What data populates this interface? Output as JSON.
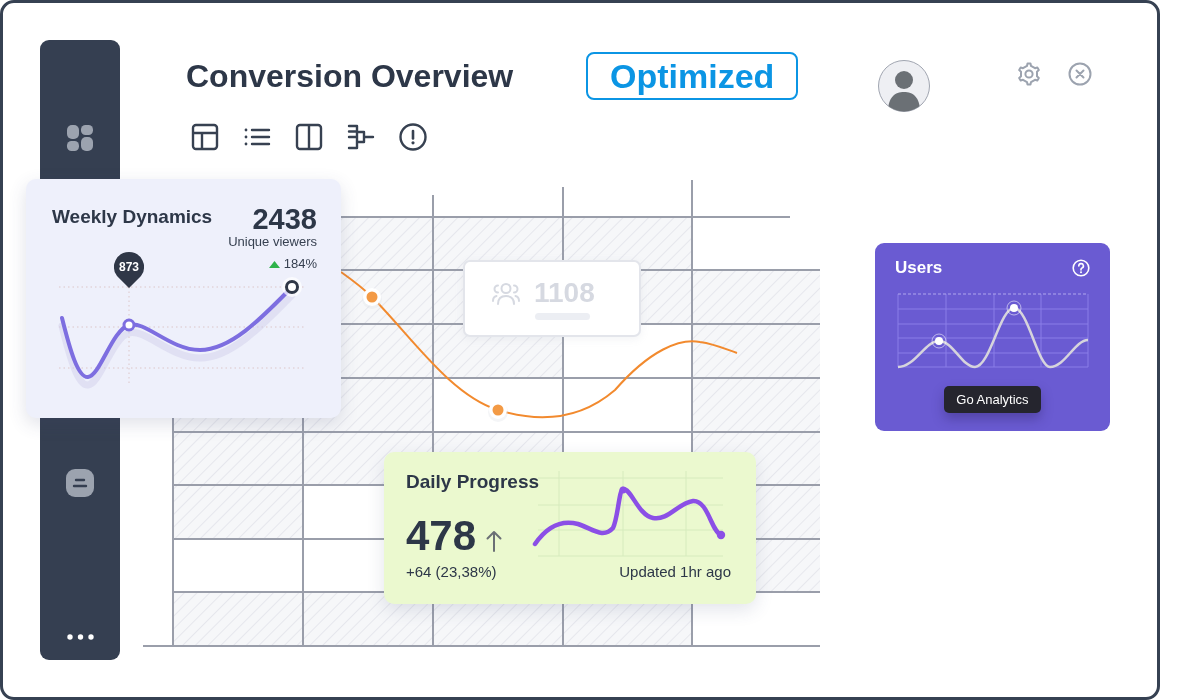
{
  "header": {
    "title": "Conversion Overview",
    "badge": "Optimized"
  },
  "weekly_dynamics": {
    "title": "Weekly Dynamics",
    "total": "2438",
    "total_label": "Unique viewers",
    "change": "184%",
    "tooltip": "873"
  },
  "stat_card": {
    "value": "1108"
  },
  "users": {
    "title": "Users",
    "button": "Go Analytics"
  },
  "daily_progress": {
    "title": "Daily Progress",
    "value": "478",
    "change": "+64 (23,38%)",
    "updated": "Updated 1hr ago"
  }
}
